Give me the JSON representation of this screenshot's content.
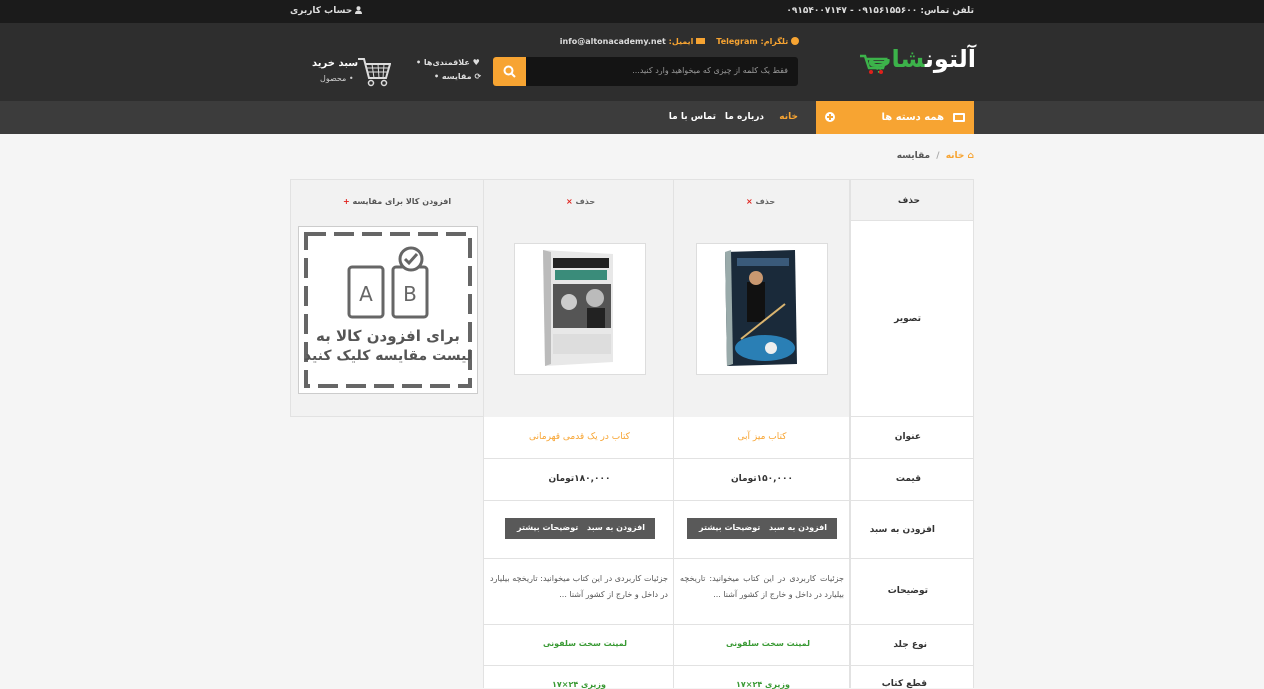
{
  "topbar": {
    "phone": "تلفن تماس: ۰۹۱۵۶۱۵۵۶۰۰ - ۰۹۱۵۴۰۰۷۱۴۷",
    "account": "حساب کاربری"
  },
  "header": {
    "logo_main": "آلتون",
    "logo_accent": "شاپ",
    "telegram_label": "تلگرام:",
    "telegram_value": "Telegram",
    "email_label": "ایمیل:",
    "email_value": "info@altonacademy.net",
    "search_placeholder": "فقط یک کلمه از چیزی که میخواهید وارد کنید...",
    "wishlist": "علاقمندی‌ها",
    "compare": "مقایسه",
    "cart_title": "سبد خرید",
    "cart_sub": "محصول"
  },
  "nav": {
    "categories": "همه دسته ها",
    "items": [
      "خانه",
      "درباره ما",
      "تماس با ما"
    ]
  },
  "breadcrumb": {
    "home": "خانه",
    "sep": "/",
    "current": "مقایسه"
  },
  "compare": {
    "row_labels": {
      "remove": "حذف",
      "image": "تصویر",
      "title": "عنوان",
      "price": "قیمت",
      "add_to_cart": "افزودن به سبد",
      "description": "توضیحات",
      "binding": "نوع جلد",
      "format": "قطع کتاب"
    },
    "remove_label": "حذف",
    "products": [
      {
        "title": "کتاب میز آبی",
        "price": "۱۵۰,۰۰۰تومان",
        "add_btn": "افزودن به سبد",
        "more_btn": "توضیحات بیشتر",
        "description": "جزئیات کاربردی در این کتاب میخوانید: تاریخچه بیلیارد در داخل و خارج از کشور آشنا ...",
        "binding": "لمینت سخت سلفونی",
        "format": "وزیری ۲۴×۱۷"
      },
      {
        "title": "کتاب در یک قدمی قهرمانی",
        "price": "۱۸۰,۰۰۰تومان",
        "add_btn": "افزودن به سبد",
        "more_btn": "توضیحات بیشتر",
        "description": "جزئیات کاربردی در این کتاب میخوانید: تاریخچه بیلیارد در داخل و خارج از کشور آشنا ...",
        "binding": "لمینت سخت سلفونی",
        "format": "وزیری ۲۴×۱۷"
      }
    ],
    "add_slot": {
      "label": "افزودن کالا برای مقایسه",
      "image_line1": "برای افزودن کالا به",
      "image_line2": "لیست مقایسه کلیک کنید"
    }
  },
  "colors": {
    "accent": "#f7a432",
    "topbar": "#1b1b1b",
    "header": "#2e2e2e",
    "nav": "#3c3c3c",
    "green": "#3a9a35",
    "remove_x": "#e0201b"
  }
}
